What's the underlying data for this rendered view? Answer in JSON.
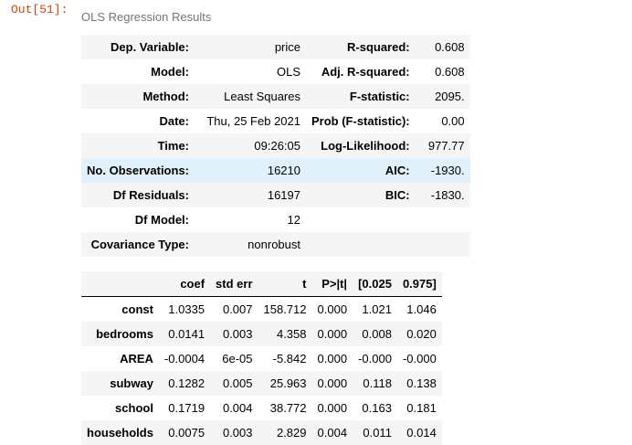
{
  "cell_prompt": "Out[51]:",
  "caption": "OLS Regression Results",
  "summary_rows": [
    [
      "Dep. Variable:",
      "price",
      "R-squared:",
      "0.608"
    ],
    [
      "Model:",
      "OLS",
      "Adj. R-squared:",
      "0.608"
    ],
    [
      "Method:",
      "Least Squares",
      "F-statistic:",
      "2095."
    ],
    [
      "Date:",
      "Thu, 25 Feb 2021",
      "Prob (F-statistic):",
      "0.00"
    ],
    [
      "Time:",
      "09:26:05",
      "Log-Likelihood:",
      "977.77"
    ],
    [
      "No. Observations:",
      "16210",
      "AIC:",
      "-1930."
    ],
    [
      "Df Residuals:",
      "16197",
      "BIC:",
      "-1830."
    ],
    [
      "Df Model:",
      "12",
      "",
      ""
    ],
    [
      "Covariance Type:",
      "nonrobust",
      "",
      ""
    ]
  ],
  "coef_headers": [
    "",
    "coef",
    "std err",
    "t",
    "P>|t|",
    "[0.025",
    "0.975]"
  ],
  "coef_rows": [
    [
      "const",
      "1.0335",
      "0.007",
      "158.712",
      "0.000",
      "1.021",
      "1.046"
    ],
    [
      "bedrooms",
      "0.0141",
      "0.003",
      "4.358",
      "0.000",
      "0.008",
      "0.020"
    ],
    [
      "AREA",
      "-0.0004",
      "6e-05",
      "-5.842",
      "0.000",
      "-0.000",
      "-0.000"
    ],
    [
      "subway",
      "0.1282",
      "0.005",
      "25.963",
      "0.000",
      "0.118",
      "0.138"
    ],
    [
      "school",
      "0.1719",
      "0.004",
      "38.772",
      "0.000",
      "0.163",
      "0.181"
    ],
    [
      "households",
      "0.0075",
      "0.003",
      "2.829",
      "0.004",
      "0.011",
      "0.014"
    ]
  ]
}
